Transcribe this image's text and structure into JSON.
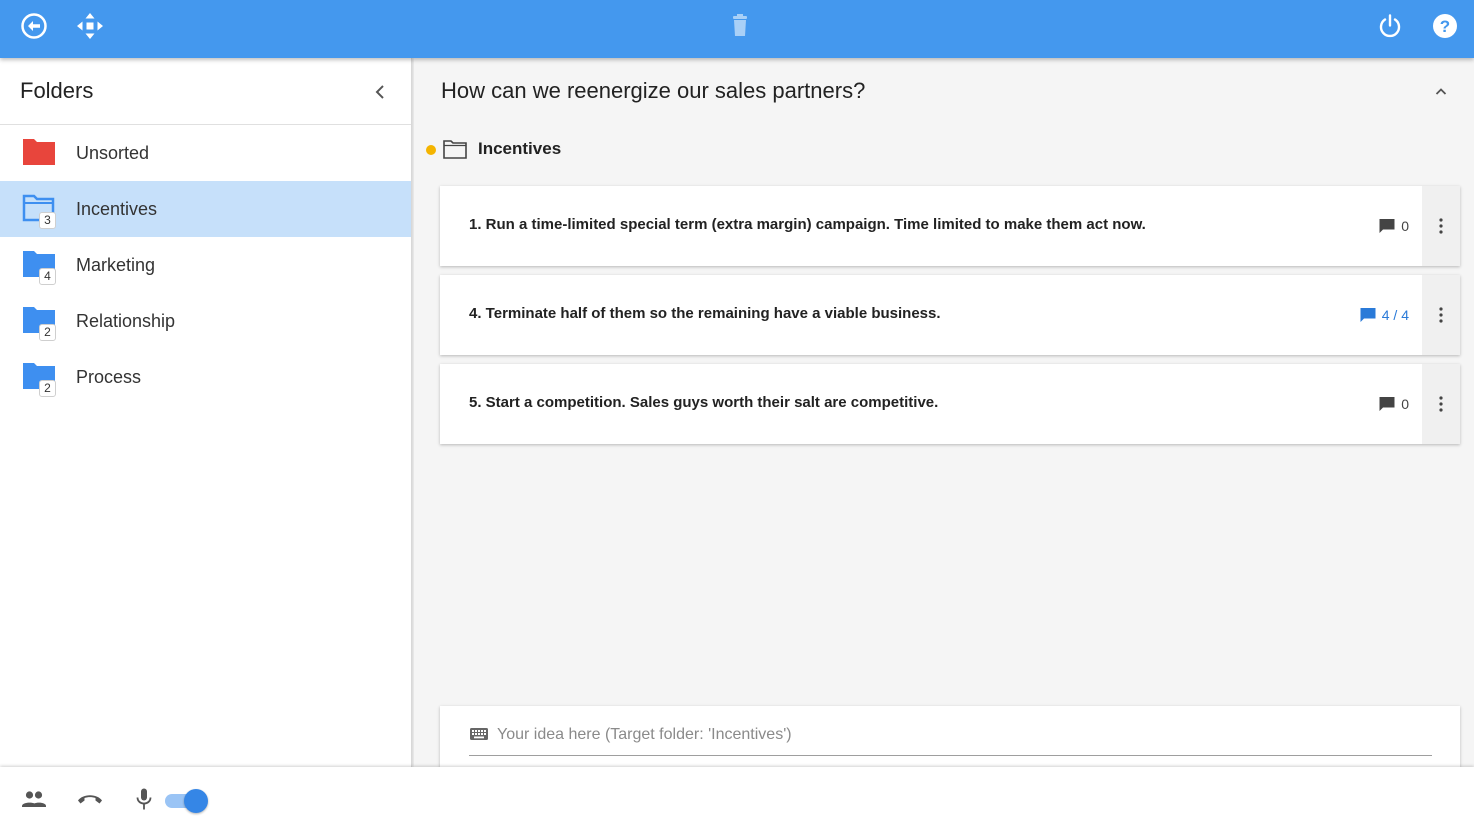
{
  "topbar": {
    "icons": [
      "back-circle-icon",
      "move-arrows-icon",
      "trash-icon",
      "power-icon",
      "help-icon"
    ],
    "color": "#4498ee"
  },
  "sidebar": {
    "title": "Folders",
    "folders": [
      {
        "label": "Unsorted",
        "count": "",
        "color": "#e8453c"
      },
      {
        "label": "Incentives",
        "count": "3",
        "color": "#3e8ff0",
        "selected": true
      },
      {
        "label": "Marketing",
        "count": "4",
        "color": "#3e8ff0"
      },
      {
        "label": "Relationship",
        "count": "2",
        "color": "#3e8ff0"
      },
      {
        "label": "Process",
        "count": "2",
        "color": "#3e8ff0"
      }
    ]
  },
  "main": {
    "question": "How can we reenergize our sales partners?",
    "group_label": "Incentives",
    "ideas": [
      {
        "text": "1. Run a time-limited special term (extra margin) campaign. Time limited to make them act now.",
        "comments": "0"
      },
      {
        "text": "4. Terminate half of them so the remaining have a viable business.",
        "comments": "4 / 4"
      },
      {
        "text": "5. Start a competition. Sales guys worth their salt are competitive.",
        "comments": "0"
      }
    ],
    "input_placeholder": "Your idea here (Target folder: 'Incentives')"
  },
  "bottombar": {
    "icons": [
      "people-icon",
      "phone-hangup-icon",
      "microphone-icon"
    ],
    "toggle_on": true
  },
  "colors": {
    "accent": "#4498ee",
    "selected_row": "#c6e0fa",
    "group_dot": "#f4b400",
    "unsorted_folder": "#e8453c"
  }
}
